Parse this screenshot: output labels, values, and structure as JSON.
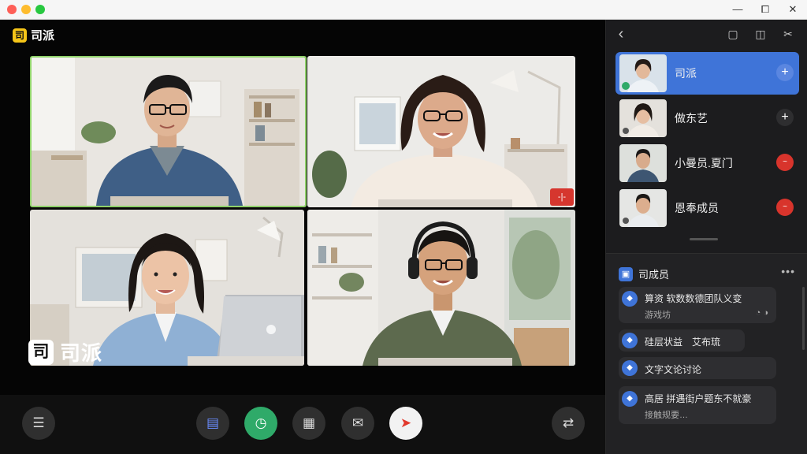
{
  "window": {
    "minimize_glyph": "—",
    "restore_glyph": "⧠",
    "close_glyph": "✕"
  },
  "app": {
    "logo_char": "司",
    "name": "司派",
    "watermark_char": "司",
    "watermark_text": "司派"
  },
  "video_tiles": [
    {
      "name": "tile-1",
      "active": true
    },
    {
      "name": "tile-2",
      "badge": "-|-"
    },
    {
      "name": "tile-3"
    },
    {
      "name": "tile-4"
    }
  ],
  "controls": [
    {
      "id": "participants",
      "glyph": "☰"
    },
    {
      "id": "layout",
      "glyph": "▤"
    },
    {
      "id": "timer",
      "glyph": "◷"
    },
    {
      "id": "share",
      "glyph": "▦"
    },
    {
      "id": "message",
      "glyph": "✉"
    },
    {
      "id": "send",
      "glyph": "➤"
    },
    {
      "id": "switch",
      "glyph": "⇄"
    }
  ],
  "panel": {
    "back_glyph": "‹",
    "icons": [
      "▢",
      "◫",
      "✂"
    ],
    "members": [
      {
        "name": "司派",
        "action": "+"
      },
      {
        "name": "做东艺",
        "action": "+"
      },
      {
        "name": "小曼员.夏门",
        "action": "~"
      },
      {
        "name": "恩奉成员",
        "action": "~"
      }
    ],
    "section": {
      "icon": "▣",
      "title": "司成员",
      "more": "•••",
      "cards": [
        {
          "icon": "◆",
          "text": "算资 软数数德团队义变",
          "sub": "游戏坊",
          "right": "◔ ◑"
        },
        {
          "icon": "◆",
          "text": "硅层状益　艾布琉"
        },
        {
          "icon": "◆",
          "text": "文字文论讨论"
        },
        {
          "icon": "◆",
          "text": "高居 拼遇街户题东不就豪",
          "sub": "接触规要…"
        }
      ]
    }
  },
  "colors": {
    "accent": "#3f74d8",
    "active_border": "#8fd16a",
    "record_green": "#2faa69",
    "danger": "#d8342c",
    "logo_yellow": "#f5c518"
  }
}
